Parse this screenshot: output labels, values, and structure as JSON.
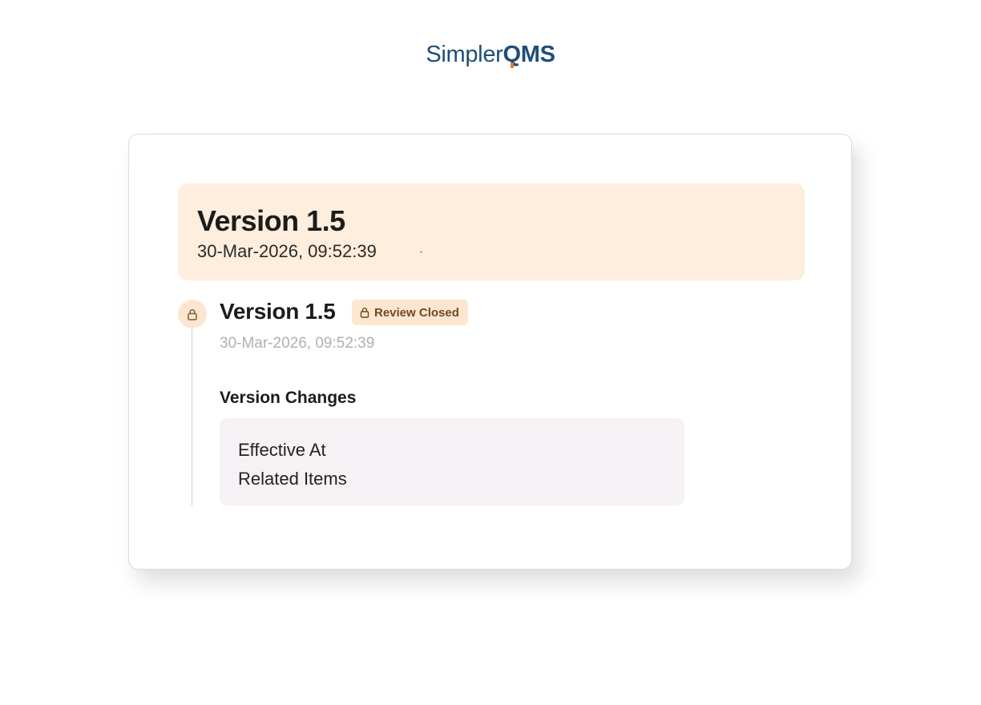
{
  "logo": {
    "part1": "Simpler",
    "part2_q": "Q",
    "part2_rest": "MS",
    "color": "#1f4e79",
    "accent": "#e8752d"
  },
  "header": {
    "title": "Version 1.5",
    "date": "30-Mar-2026, 09:52:39"
  },
  "entry": {
    "icon": "lock-icon",
    "title": "Version 1.5",
    "badge_label": "Review Closed",
    "badge_icon": "lock-icon",
    "date": "30-Mar-2026, 09:52:39"
  },
  "changes": {
    "heading": "Version Changes",
    "items": [
      "Effective At",
      "Related Items"
    ]
  },
  "colors": {
    "header_bg": "#fdeedd",
    "badge_bg": "#fde6cf",
    "changes_bg": "#f6f1f4"
  }
}
